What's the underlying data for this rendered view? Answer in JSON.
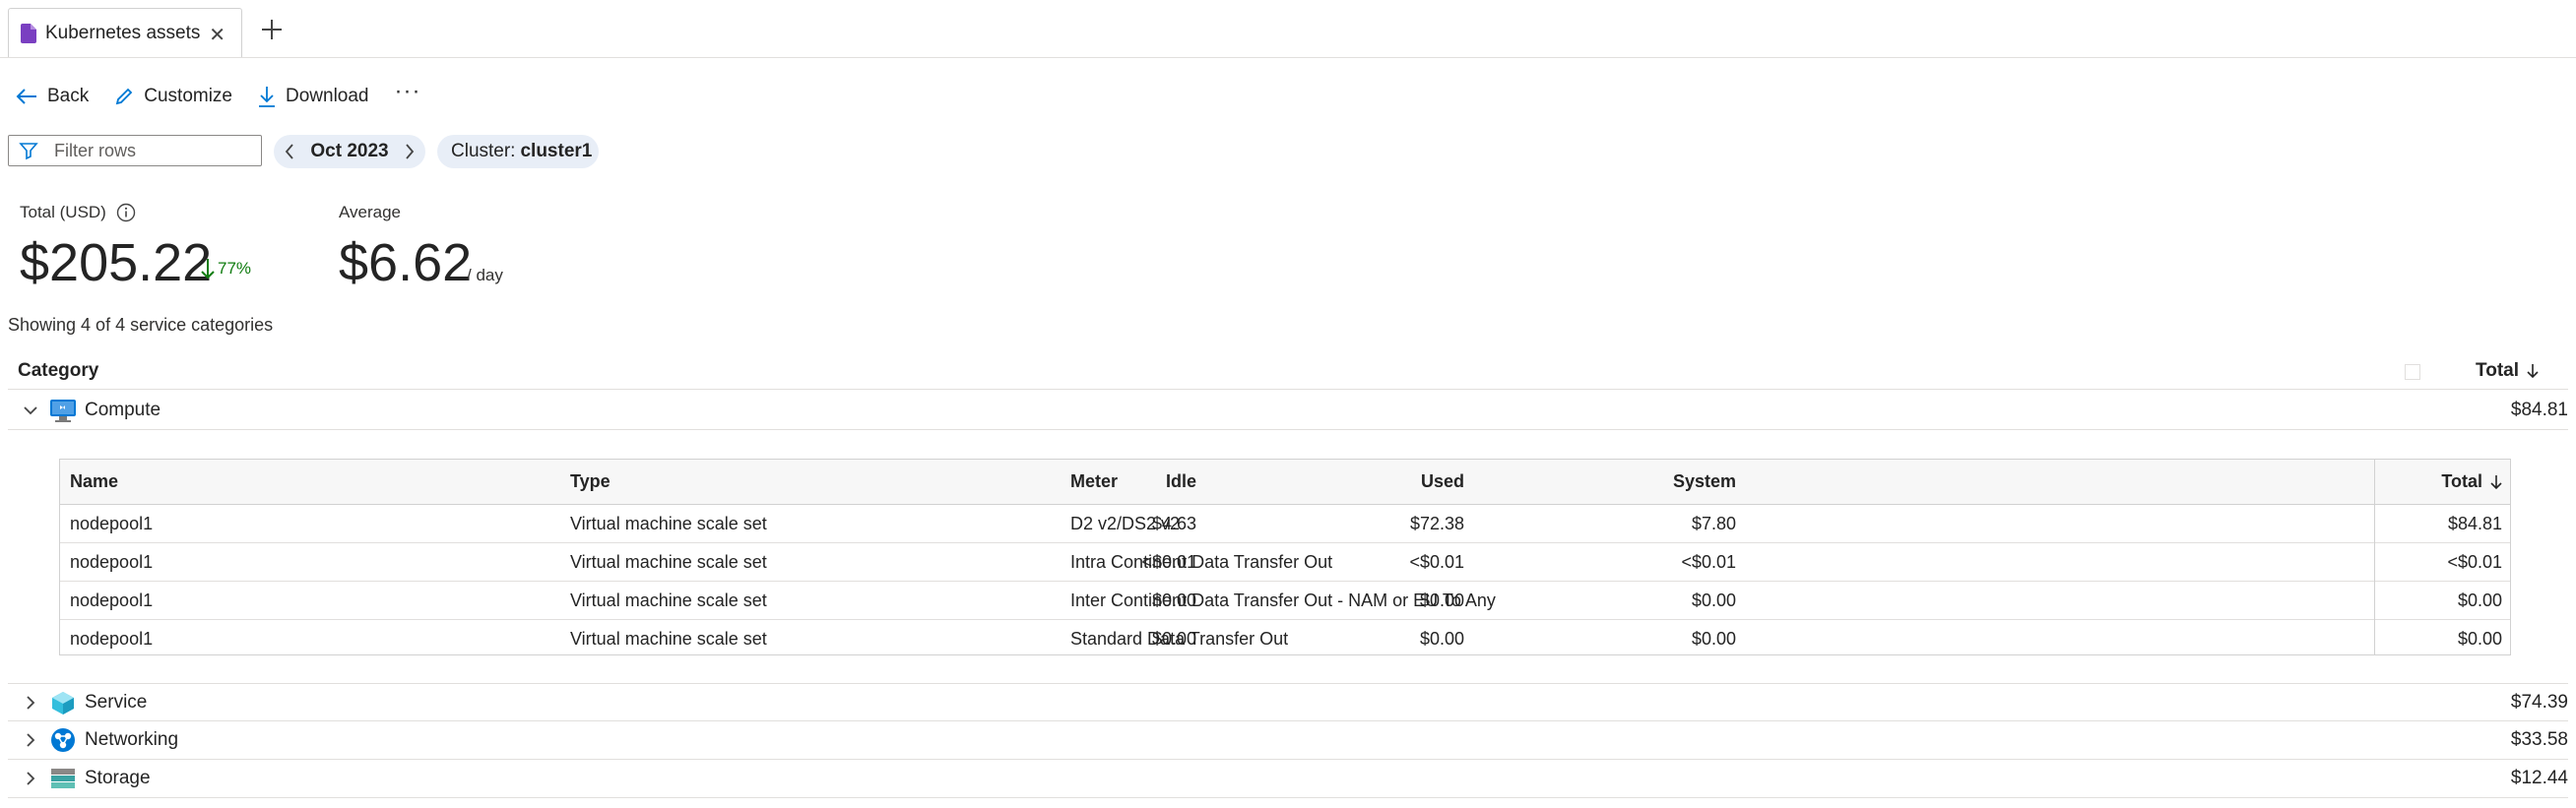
{
  "tab": {
    "title": "Kubernetes assets",
    "close": "✕"
  },
  "commands": {
    "back": "Back",
    "customize": "Customize",
    "download": "Download",
    "more": "···"
  },
  "filter": {
    "placeholder": "Filter rows",
    "value": ""
  },
  "date_pill": {
    "label": "Oct 2023",
    "prev": "‹",
    "next": "›"
  },
  "cluster_pill": {
    "prefix": "Cluster:",
    "value": "cluster1"
  },
  "kpi": {
    "total_label": "Total (USD)",
    "total_value": "$205.22",
    "trend": "77%",
    "average_label": "Average",
    "average_value": "$6.62",
    "average_unit": "/ day"
  },
  "showing": "Showing 4 of 4 service categories",
  "table": {
    "headers": {
      "category": "Category",
      "total": "Total"
    },
    "categories": [
      {
        "name": "Compute",
        "total": "$84.81",
        "expanded": true,
        "icon": "compute-icon"
      },
      {
        "name": "Service",
        "total": "$74.39",
        "expanded": false,
        "icon": "service-icon"
      },
      {
        "name": "Networking",
        "total": "$33.58",
        "expanded": false,
        "icon": "networking-icon"
      },
      {
        "name": "Storage",
        "total": "$12.44",
        "expanded": false,
        "icon": "storage-icon"
      }
    ],
    "detail": {
      "headers": {
        "name": "Name",
        "type": "Type",
        "meter": "Meter",
        "idle": "Idle",
        "used": "Used",
        "system": "System",
        "total": "Total"
      },
      "rows": [
        {
          "name": "nodepool1",
          "type": "Virtual machine scale set",
          "meter": "D2 v2/DS2 v2",
          "idle": "$4.63",
          "used": "$72.38",
          "system": "$7.80",
          "total": "$84.81"
        },
        {
          "name": "nodepool1",
          "type": "Virtual machine scale set",
          "meter": "Intra Continent Data Transfer Out",
          "idle": "<$0.01",
          "used": "<$0.01",
          "system": "<$0.01",
          "total": "<$0.01"
        },
        {
          "name": "nodepool1",
          "type": "Virtual machine scale set",
          "meter": "Inter Continent Data Transfer Out - NAM or EU To Any",
          "idle": "$0.00",
          "used": "$0.00",
          "system": "$0.00",
          "total": "$0.00"
        },
        {
          "name": "nodepool1",
          "type": "Virtual machine scale set",
          "meter": "Standard Data Transfer Out",
          "idle": "$0.00",
          "used": "$0.00",
          "system": "$0.00",
          "total": "$0.00"
        }
      ]
    }
  },
  "colors": {
    "accent": "#0078d4",
    "trend_down": "#107c10",
    "pill_bg": "#e8eef7"
  }
}
